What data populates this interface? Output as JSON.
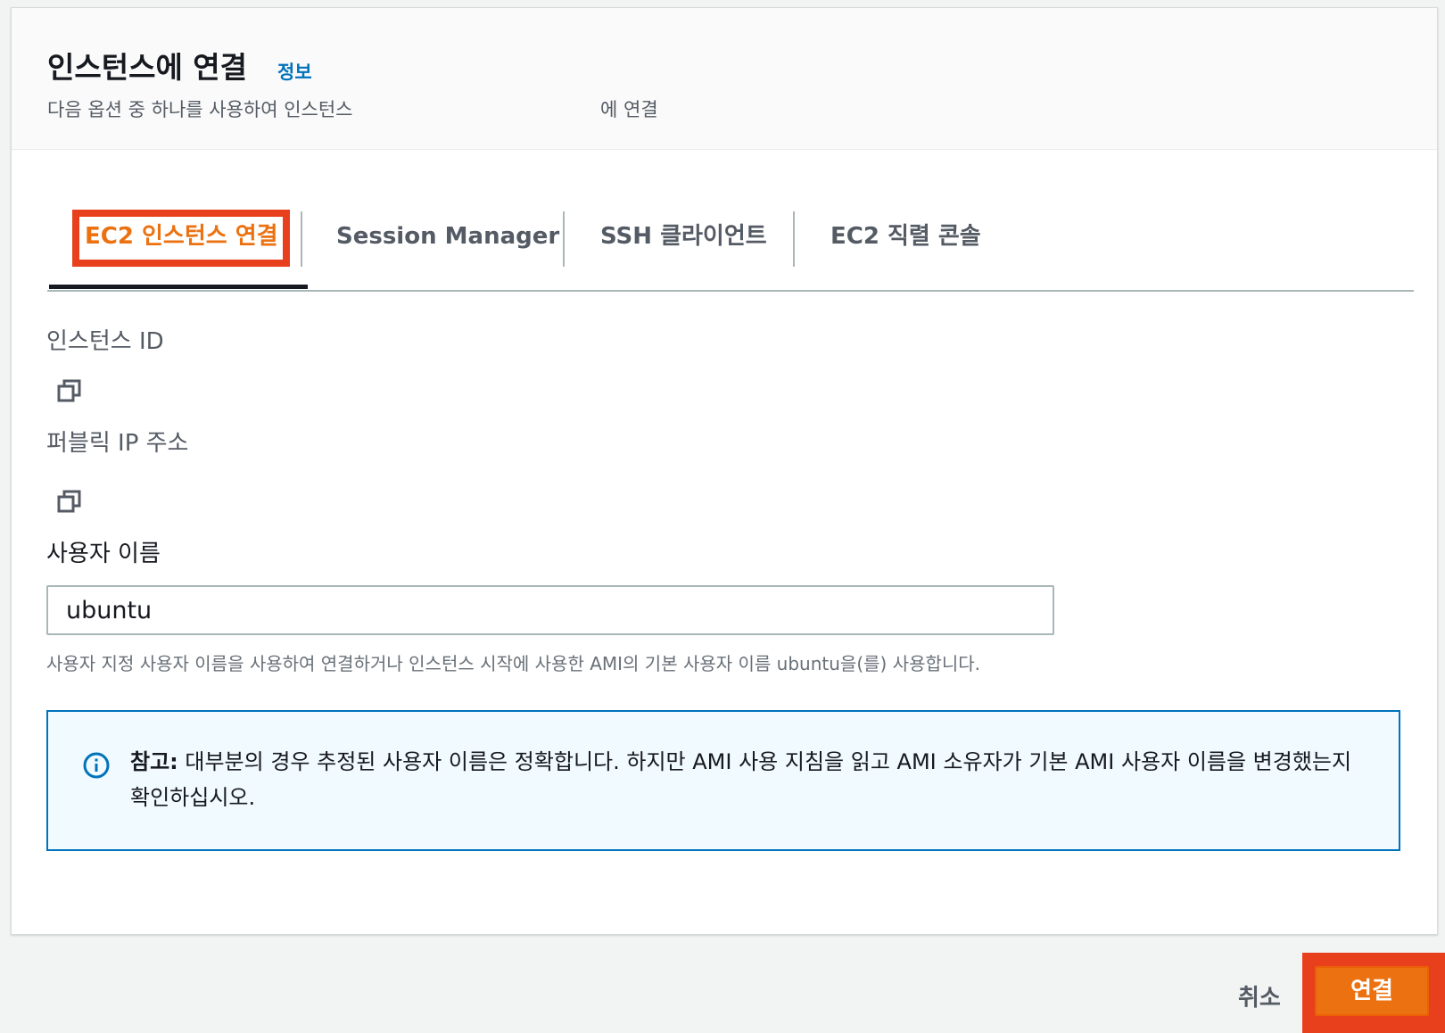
{
  "header": {
    "title": "인스턴스에 연결",
    "info_link": "정보",
    "subtitle_left": "다음 옵션 중 하나를 사용하여 인스턴스",
    "subtitle_right": "에 연결"
  },
  "tabs": [
    {
      "label": "EC2 인스턴스 연결",
      "active": true
    },
    {
      "label": "Session Manager",
      "active": false
    },
    {
      "label": "SSH 클라이언트",
      "active": false
    },
    {
      "label": "EC2 직렬 콘솔",
      "active": false
    }
  ],
  "form": {
    "instance_id_label": "인스턴스 ID",
    "public_ip_label": "퍼블릭 IP 주소",
    "username_label": "사용자 이름",
    "username_value": "ubuntu",
    "username_hint": "사용자 지정 사용자 이름을 사용하여 연결하거나 인스턴스 시작에 사용한 AMI의 기본 사용자 이름 ubuntu을(를) 사용합니다."
  },
  "alert": {
    "prefix": "참고:",
    "text": " 대부분의 경우 추정된 사용자 이름은 정확합니다. 하지만 AMI 사용 지침을 읽고 AMI 소유자가 기본 AMI 사용자 이름을 변경했는지 확인하십시오.",
    "icon": "info-icon"
  },
  "footer": {
    "cancel_label": "취소",
    "connect_label": "연결"
  },
  "colors": {
    "accent_orange": "#ec7211",
    "highlight_red": "#e8401c",
    "link_blue": "#0073bb",
    "alert_bg": "#f1faff"
  }
}
